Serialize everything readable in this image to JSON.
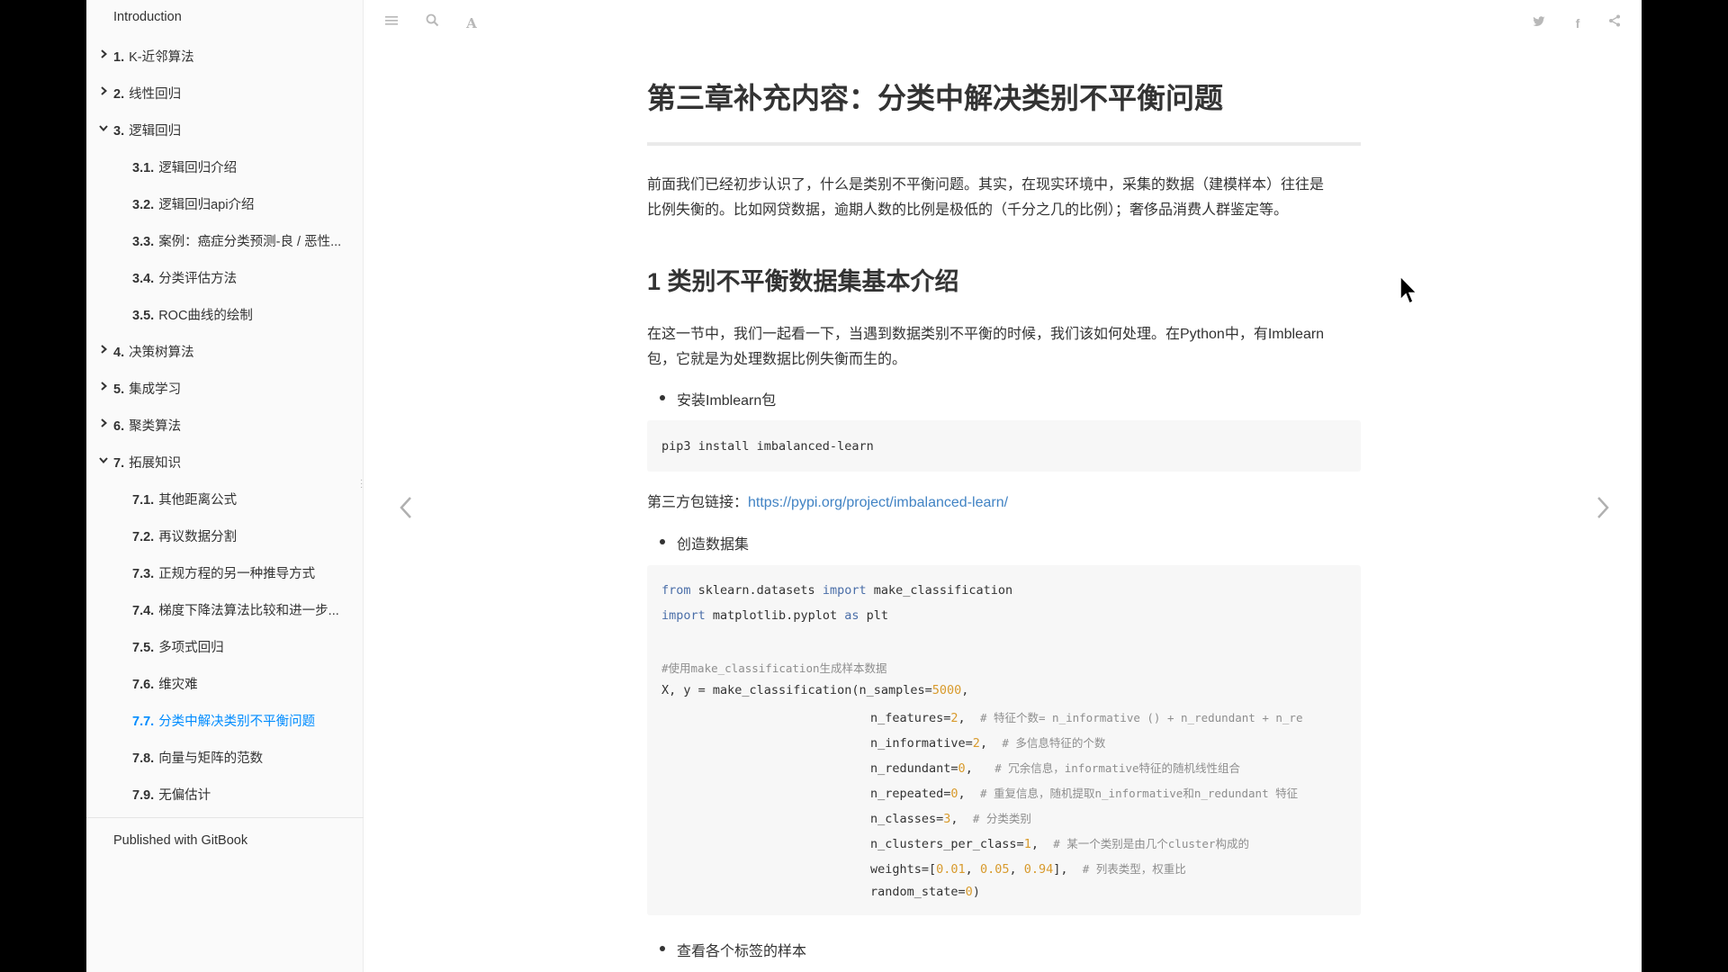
{
  "sidebar": {
    "intro": "Introduction",
    "items": [
      {
        "num": "1.",
        "label": "K-近邻算法",
        "chevron": "right"
      },
      {
        "num": "2.",
        "label": "线性回归",
        "chevron": "right"
      },
      {
        "num": "3.",
        "label": "逻辑回归",
        "chevron": "down"
      },
      {
        "num": "3.1.",
        "label": "逻辑回归介绍"
      },
      {
        "num": "3.2.",
        "label": "逻辑回归api介绍"
      },
      {
        "num": "3.3.",
        "label": "案例：癌症分类预测-良 / 恶性..."
      },
      {
        "num": "3.4.",
        "label": "分类评估方法"
      },
      {
        "num": "3.5.",
        "label": "ROC曲线的绘制"
      },
      {
        "num": "4.",
        "label": "决策树算法",
        "chevron": "right"
      },
      {
        "num": "5.",
        "label": "集成学习",
        "chevron": "right"
      },
      {
        "num": "6.",
        "label": "聚类算法",
        "chevron": "right"
      },
      {
        "num": "7.",
        "label": "拓展知识",
        "chevron": "down"
      },
      {
        "num": "7.1.",
        "label": "其他距离公式"
      },
      {
        "num": "7.2.",
        "label": "再议数据分割"
      },
      {
        "num": "7.3.",
        "label": "正规方程的另一种推导方式"
      },
      {
        "num": "7.4.",
        "label": "梯度下降法算法比较和进一步..."
      },
      {
        "num": "7.5.",
        "label": "多项式回归"
      },
      {
        "num": "7.6.",
        "label": "维灾难"
      },
      {
        "num": "7.7.",
        "label": "分类中解决类别不平衡问题",
        "active": true
      },
      {
        "num": "7.8.",
        "label": "向量与矩阵的范数"
      },
      {
        "num": "7.9.",
        "label": "无偏估计"
      }
    ],
    "published": "Published with GitBook"
  },
  "toolbar": {
    "left_icons": [
      "menu-icon",
      "search-icon",
      "font-settings-icon"
    ],
    "right_icons": [
      "twitter-icon",
      "facebook-icon",
      "share-icon"
    ]
  },
  "content": {
    "title": "第三章补充内容：分类中解决类别不平衡问题",
    "intro_line1": "前面我们已经初步认识了，什么是类别不平衡问题。其实，在现实环境中，采集的数据（建模样本）往往是",
    "intro_line2": "比例失衡的。比如网贷数据，逾期人数的比例是极低的（千分之几的比例）；奢侈品消费人群鉴定等。",
    "section1_title": "1 类别不平衡数据集基本介绍",
    "section1_line1": "在这一节中，我们一起看一下，当遇到数据类别不平衡的时候，我们该如何处理。在Python中，有Imblearn",
    "section1_line2": "包，它就是为处理数据比例失衡而生的。",
    "bullet1": "安装Imblearn包",
    "code1": "pip3 install imbalanced-learn",
    "third_party_label": "第三方包链接：",
    "third_party_link": "https://pypi.org/project/imbalanced-learn/",
    "bullet2": "创造数据集",
    "code2": {
      "l1_kw1": "from",
      "l1_mod": " sklearn.datasets ",
      "l1_kw2": "import",
      "l1_name": " make_classification",
      "l2_kw1": "import",
      "l2_mod": " matplotlib.pyplot ",
      "l2_kw2": "as",
      "l2_name": " plt",
      "l3_comment": "#使用make_classification生成样本数据",
      "l4_a": "X, y = make_classification(n_samples=",
      "l4_num": "5000",
      "l4_b": ",",
      "l5_a": "n_features=",
      "l5_num": "2",
      "l5_b": ",  ",
      "l5_cm": "# 特征个数= n_informative () + n_redundant + n_re",
      "l6_a": "n_informative=",
      "l6_num": "2",
      "l6_b": ",  ",
      "l6_cm": "# 多信息特征的个数",
      "l7_a": "n_redundant=",
      "l7_num": "0",
      "l7_b": ",   ",
      "l7_cm": "# 冗余信息，informative特征的随机线性组合",
      "l8_a": "n_repeated=",
      "l8_num": "0",
      "l8_b": ",  ",
      "l8_cm": "# 重复信息，随机提取n_informative和n_redundant 特征",
      "l9_a": "n_classes=",
      "l9_num": "3",
      "l9_b": ",  ",
      "l9_cm": "# 分类类别",
      "l10_a": "n_clusters_per_class=",
      "l10_num": "1",
      "l10_b": ",  ",
      "l10_cm": "# 某一个类别是由几个cluster构成的",
      "l11_a": "weights=[",
      "l11_n1": "0.01",
      "l11_s1": ", ",
      "l11_n2": "0.05",
      "l11_s2": ", ",
      "l11_n3": "0.94",
      "l11_b": "],  ",
      "l11_cm": "# 列表类型，权重比",
      "l12_a": "random_state=",
      "l12_num": "0",
      "l12_b": ")"
    },
    "bullet3": "查看各个标签的样本"
  },
  "nav": {
    "prev": "‹",
    "next": "›"
  }
}
